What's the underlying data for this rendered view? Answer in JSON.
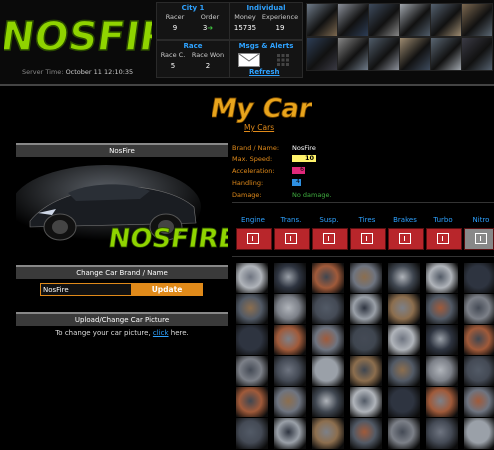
{
  "header": {
    "logo_text": "NOSFIRE",
    "server_time_label": "Server Time:",
    "server_time_value": "October 11 12:10:35",
    "city": {
      "title": "City 1",
      "racer_label": "Racer",
      "racer_value": "9",
      "order_label": "Order",
      "order_value": "3"
    },
    "individual": {
      "title": "Individual",
      "money_label": "Money",
      "money_value": "15735",
      "experience_label": "Experience",
      "experience_value": "19"
    },
    "race": {
      "title": "Race",
      "race_c_label": "Race C.",
      "race_c_value": "5",
      "race_won_label": "Race Won",
      "race_won_value": "2"
    },
    "msgs": {
      "title": "Msgs & Alerts"
    },
    "refresh_label": "Refresh",
    "thumb_colors": [
      "#6e7a88",
      "#8a8f99",
      "#3d4a5c",
      "#a0a6ad",
      "#54606e",
      "#7b6850",
      "#2d3d55",
      "#868686",
      "#4f5b68",
      "#9c8a70",
      "#5a6672",
      "#3a3a44"
    ]
  },
  "page": {
    "title": "My Car",
    "my_cars_link": "My Cars"
  },
  "car_panel": {
    "title": "NosFire",
    "image_text": "NOSFIRE"
  },
  "stats": {
    "brand_label": "Brand / Name:",
    "brand_value": "NosFire",
    "max_speed_label": "Max. Speed:",
    "max_speed_value": "10",
    "max_speed_color": "#fff36b",
    "acceleration_label": "Acceleration:",
    "acceleration_value": "6",
    "acceleration_color": "#e0287a",
    "handling_label": "Handling:",
    "handling_value": "4",
    "handling_color": "#2e8fe0",
    "damage_label": "Damage:",
    "damage_value": "No damage.",
    "damage_color": "#3fae3f"
  },
  "change_name": {
    "title": "Change Car Brand / Name",
    "input_value": "NosFire",
    "update_label": "Update"
  },
  "upload": {
    "title": "Upload/Change Car Picture",
    "text_before": "To change your car picture, ",
    "link": "click",
    "text_after": " here."
  },
  "parts": [
    {
      "name": "Engine"
    },
    {
      "name": "Trans."
    },
    {
      "name": "Susp."
    },
    {
      "name": "Tires"
    },
    {
      "name": "Brakes"
    },
    {
      "name": "Turbo"
    },
    {
      "name": "Nitro"
    }
  ],
  "accent_colors": {
    "orange": "#e08a1a",
    "blue": "#2ea2ff",
    "part_red": "#b8262b"
  }
}
